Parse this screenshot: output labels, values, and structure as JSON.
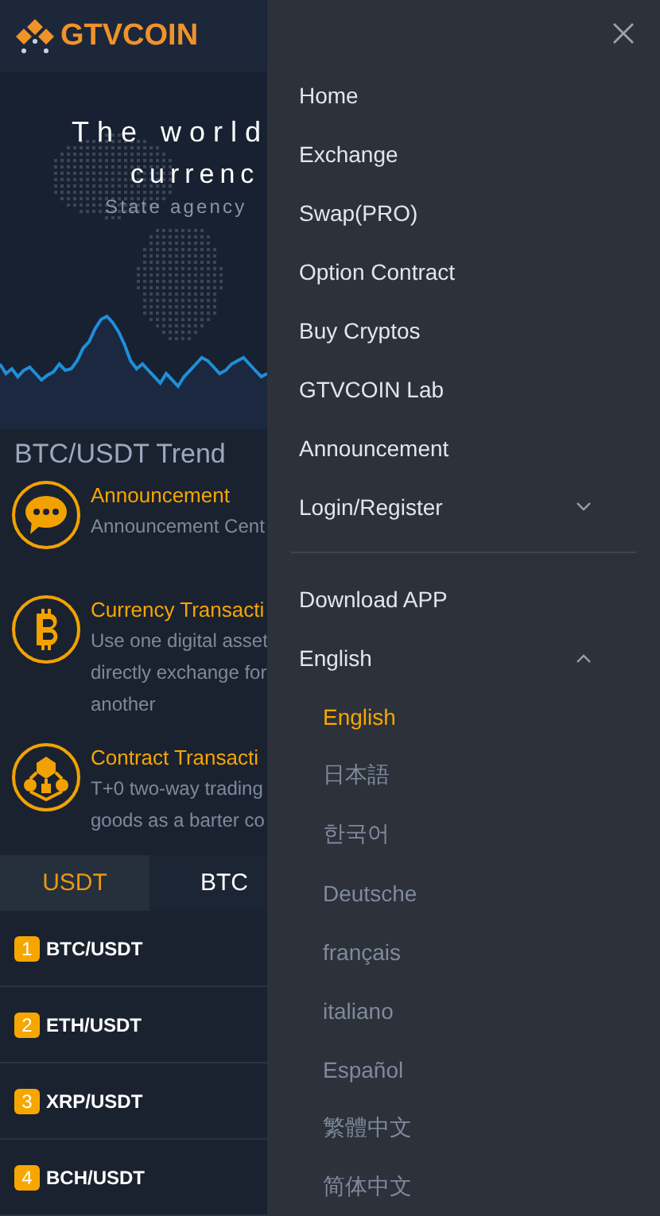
{
  "header": {
    "logo_text": "GTVCOIN"
  },
  "hero": {
    "title_line_1": "The world",
    "title_line_2": "currenc",
    "subtitle": "State agency"
  },
  "trend": {
    "title": "BTC/USDT Trend"
  },
  "features": [
    {
      "kind": "chat",
      "title": "Announcement",
      "lines": [
        "Announcement Cent"
      ]
    },
    {
      "kind": "bitcoin",
      "title": "Currency Transacti",
      "lines": [
        "Use one digital asset",
        "directly exchange for",
        "another"
      ]
    },
    {
      "kind": "network",
      "title": "Contract Transacti",
      "lines": [
        "T+0 two-way trading",
        "goods as a barter co"
      ]
    }
  ],
  "market_tabs": [
    {
      "label": "USDT",
      "selected": true
    },
    {
      "label": "BTC",
      "selected": false
    }
  ],
  "markets": [
    {
      "rank": "1",
      "pair": "BTC/USDT"
    },
    {
      "rank": "2",
      "pair": "ETH/USDT"
    },
    {
      "rank": "3",
      "pair": "XRP/USDT"
    },
    {
      "rank": "4",
      "pair": "BCH/USDT"
    }
  ],
  "drawer": {
    "nav": [
      {
        "label": "Home"
      },
      {
        "label": "Exchange"
      },
      {
        "label": "Swap(PRO)"
      },
      {
        "label": "Option Contract"
      },
      {
        "label": "Buy Cryptos"
      },
      {
        "label": "GTVCOIN Lab"
      },
      {
        "label": "Announcement"
      },
      {
        "label": "Login/Register",
        "expanded": false
      }
    ],
    "bottom": [
      {
        "label": "Download APP"
      },
      {
        "label": "English",
        "expanded": true
      }
    ],
    "languages": [
      {
        "label": "English",
        "selected": true
      },
      {
        "label": "日本語",
        "selected": false
      },
      {
        "label": "한국어",
        "selected": false
      },
      {
        "label": "Deutsche",
        "selected": false
      },
      {
        "label": "français",
        "selected": false
      },
      {
        "label": "italiano",
        "selected": false
      },
      {
        "label": "Español",
        "selected": false
      },
      {
        "label": "繁體中文",
        "selected": false
      },
      {
        "label": "简体中文",
        "selected": false
      }
    ]
  }
}
